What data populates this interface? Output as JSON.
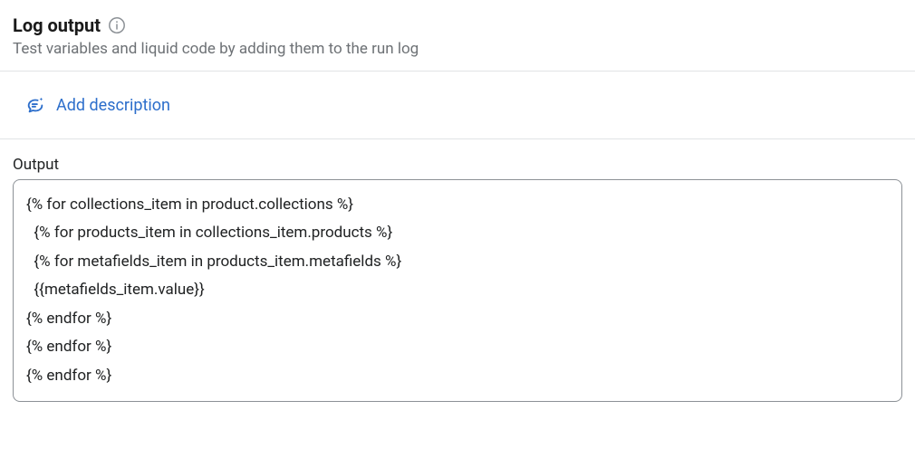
{
  "header": {
    "title": "Log output",
    "subtitle": "Test variables and liquid code by adding them to the run log"
  },
  "description": {
    "add_label": "Add description"
  },
  "output": {
    "label": "Output",
    "code": "{% for collections_item in product.collections %}\n  {% for products_item in collections_item.products %}\n  {% for metafields_item in products_item.metafields %}\n  {{metafields_item.value}}\n{% endfor %}\n{% endfor %}\n{% endfor %}"
  }
}
